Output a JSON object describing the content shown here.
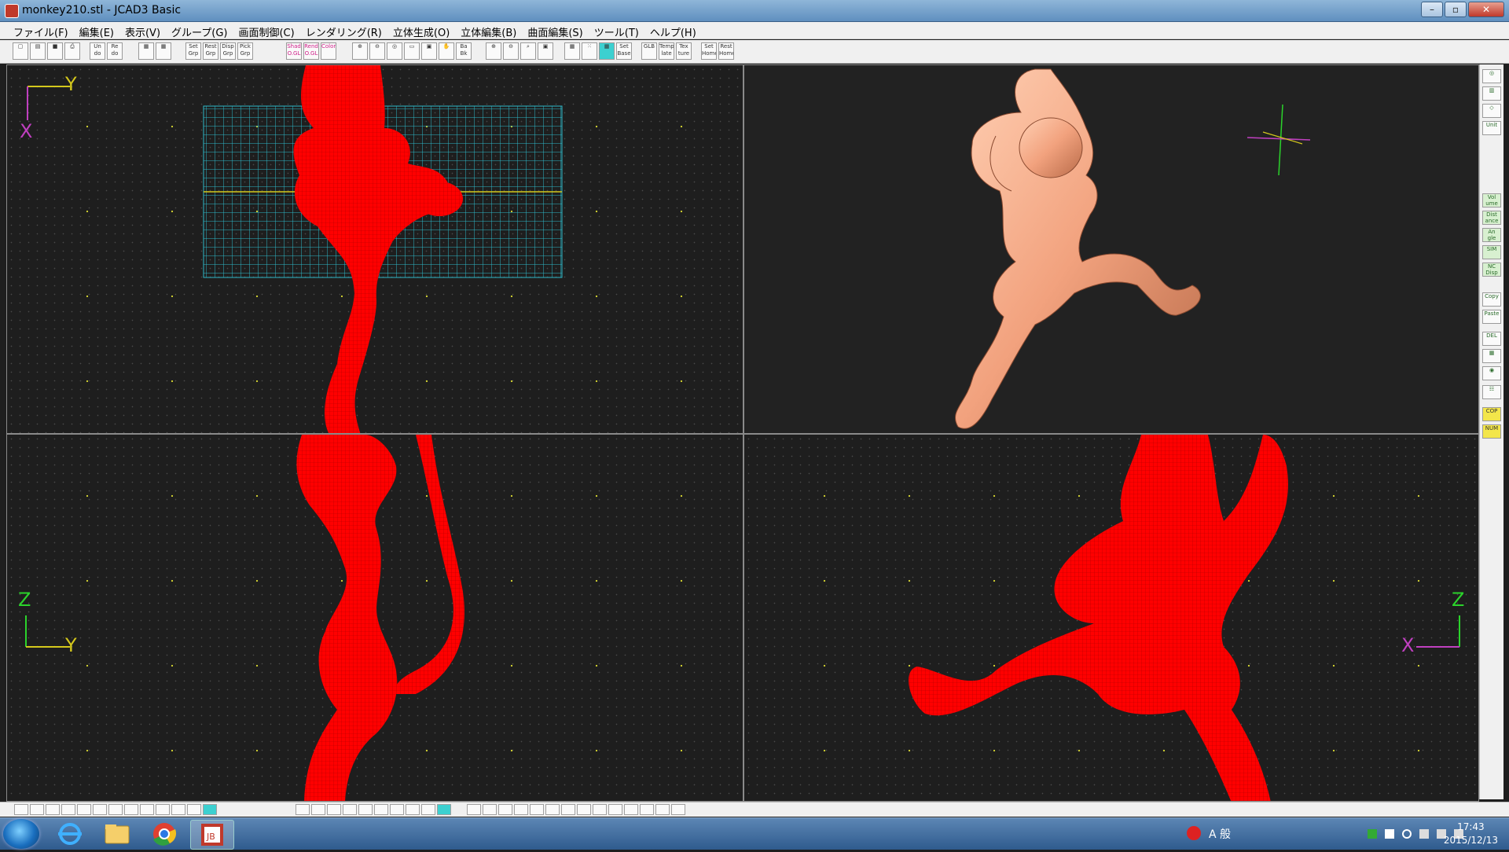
{
  "window": {
    "title": "monkey210.stl - JCAD3 Basic",
    "controls": [
      "–",
      "▫",
      "✕"
    ]
  },
  "menu": {
    "items": [
      "ファイル(F)",
      "編集(E)",
      "表示(V)",
      "グループ(G)",
      "画面制御(C)",
      "レンダリング(R)",
      "立体生成(O)",
      "立体編集(B)",
      "曲面編集(S)",
      "ツール(T)",
      "ヘルプ(H)"
    ]
  },
  "toolbar": {
    "set_grp": "Set Grp",
    "rest_grp": "Rest Grp",
    "disp_grp": "Disp Grp",
    "pick_grp": "Pick Grp",
    "shad": "Shad O.GL",
    "rend": "Rend O.GL",
    "color": "Color",
    "ba_bk": "Ba Bk",
    "glb": "GLB",
    "template": "Temp late",
    "texture": "Tex ture",
    "set_base": "Set Base",
    "set_home": "Set Home",
    "rest_home": "Rest Home"
  },
  "viewports": {
    "top": {
      "axis_v": "Y",
      "axis_h": "X"
    },
    "front": {
      "axis_v": "Z",
      "axis_h": "Y"
    },
    "side": {
      "axis_v": "Z",
      "axis_h": "X"
    }
  },
  "palette": {
    "volume": "Vol ume",
    "distance": "Dist ance",
    "angle": "An gle",
    "sim": "SIM",
    "nc_disp": "NC Disp",
    "copy": "Copy",
    "paste": "Paste",
    "del": "DEL",
    "cop": "COP",
    "num": "NUM",
    "unit": "Unit"
  },
  "taskbar": {
    "ime_mode": "A 般",
    "time": "17:43",
    "date": "2015/12/13"
  },
  "colors": {
    "wireframe": "#ff0000",
    "render": "#f2a27e",
    "background": "#1e1e1e",
    "grid": "#2fb8c8",
    "gridline_axis": "#d4c81c"
  }
}
